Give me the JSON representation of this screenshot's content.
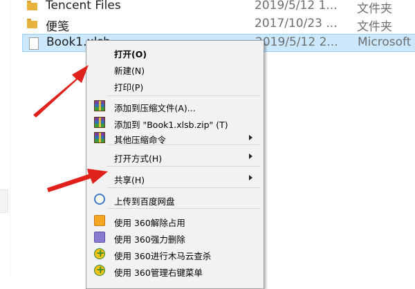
{
  "files": [
    {
      "name": "Tencent Files",
      "date": "2019/5/12 1...",
      "type": "文件夹",
      "icon": "folder-icon"
    },
    {
      "name": "便笺",
      "date": "2017/10/23 ...",
      "type": "文件夹",
      "icon": "folder-icon"
    },
    {
      "name": "Book1.xlsb",
      "date": "2019/5/12 2...",
      "type": "Microsoft",
      "icon": "document-icon"
    }
  ],
  "context_menu": {
    "items": {
      "open": "打开(O)",
      "new": "新建(N)",
      "print": "打印(P)",
      "add_to_archive": "添加到压缩文件(A)...",
      "add_to_zip": "添加到 \"Book1.xlsb.zip\" (T)",
      "other_compress": "其他压缩命令",
      "open_with": "打开方式(H)",
      "share": "共享(H)",
      "upload_baidu": "上传到百度网盘",
      "unlock_360": "使用 360解除占用",
      "shred_360": "使用 360强力删除",
      "scan_360": "使用 360进行木马云查杀",
      "manage_360": "使用 360管理右键菜单"
    }
  },
  "colors": {
    "selection_bg": "#cce8ff",
    "menu_bg": "#f2f2f2",
    "arrow_red": "#e0201a"
  }
}
